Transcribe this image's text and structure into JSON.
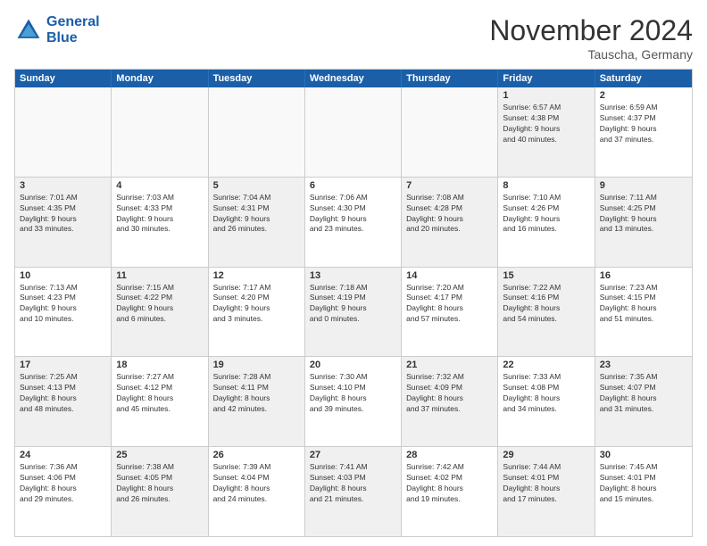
{
  "header": {
    "logo_line1": "General",
    "logo_line2": "Blue",
    "month": "November 2024",
    "location": "Tauscha, Germany"
  },
  "weekdays": [
    "Sunday",
    "Monday",
    "Tuesday",
    "Wednesday",
    "Thursday",
    "Friday",
    "Saturday"
  ],
  "rows": [
    [
      {
        "day": "",
        "info": "",
        "empty": true
      },
      {
        "day": "",
        "info": "",
        "empty": true
      },
      {
        "day": "",
        "info": "",
        "empty": true
      },
      {
        "day": "",
        "info": "",
        "empty": true
      },
      {
        "day": "",
        "info": "",
        "empty": true
      },
      {
        "day": "1",
        "info": "Sunrise: 6:57 AM\nSunset: 4:38 PM\nDaylight: 9 hours\nand 40 minutes.",
        "shaded": true
      },
      {
        "day": "2",
        "info": "Sunrise: 6:59 AM\nSunset: 4:37 PM\nDaylight: 9 hours\nand 37 minutes.",
        "shaded": false
      }
    ],
    [
      {
        "day": "3",
        "info": "Sunrise: 7:01 AM\nSunset: 4:35 PM\nDaylight: 9 hours\nand 33 minutes.",
        "shaded": true
      },
      {
        "day": "4",
        "info": "Sunrise: 7:03 AM\nSunset: 4:33 PM\nDaylight: 9 hours\nand 30 minutes.",
        "shaded": false
      },
      {
        "day": "5",
        "info": "Sunrise: 7:04 AM\nSunset: 4:31 PM\nDaylight: 9 hours\nand 26 minutes.",
        "shaded": true
      },
      {
        "day": "6",
        "info": "Sunrise: 7:06 AM\nSunset: 4:30 PM\nDaylight: 9 hours\nand 23 minutes.",
        "shaded": false
      },
      {
        "day": "7",
        "info": "Sunrise: 7:08 AM\nSunset: 4:28 PM\nDaylight: 9 hours\nand 20 minutes.",
        "shaded": true
      },
      {
        "day": "8",
        "info": "Sunrise: 7:10 AM\nSunset: 4:26 PM\nDaylight: 9 hours\nand 16 minutes.",
        "shaded": false
      },
      {
        "day": "9",
        "info": "Sunrise: 7:11 AM\nSunset: 4:25 PM\nDaylight: 9 hours\nand 13 minutes.",
        "shaded": true
      }
    ],
    [
      {
        "day": "10",
        "info": "Sunrise: 7:13 AM\nSunset: 4:23 PM\nDaylight: 9 hours\nand 10 minutes.",
        "shaded": false
      },
      {
        "day": "11",
        "info": "Sunrise: 7:15 AM\nSunset: 4:22 PM\nDaylight: 9 hours\nand 6 minutes.",
        "shaded": true
      },
      {
        "day": "12",
        "info": "Sunrise: 7:17 AM\nSunset: 4:20 PM\nDaylight: 9 hours\nand 3 minutes.",
        "shaded": false
      },
      {
        "day": "13",
        "info": "Sunrise: 7:18 AM\nSunset: 4:19 PM\nDaylight: 9 hours\nand 0 minutes.",
        "shaded": true
      },
      {
        "day": "14",
        "info": "Sunrise: 7:20 AM\nSunset: 4:17 PM\nDaylight: 8 hours\nand 57 minutes.",
        "shaded": false
      },
      {
        "day": "15",
        "info": "Sunrise: 7:22 AM\nSunset: 4:16 PM\nDaylight: 8 hours\nand 54 minutes.",
        "shaded": true
      },
      {
        "day": "16",
        "info": "Sunrise: 7:23 AM\nSunset: 4:15 PM\nDaylight: 8 hours\nand 51 minutes.",
        "shaded": false
      }
    ],
    [
      {
        "day": "17",
        "info": "Sunrise: 7:25 AM\nSunset: 4:13 PM\nDaylight: 8 hours\nand 48 minutes.",
        "shaded": true
      },
      {
        "day": "18",
        "info": "Sunrise: 7:27 AM\nSunset: 4:12 PM\nDaylight: 8 hours\nand 45 minutes.",
        "shaded": false
      },
      {
        "day": "19",
        "info": "Sunrise: 7:28 AM\nSunset: 4:11 PM\nDaylight: 8 hours\nand 42 minutes.",
        "shaded": true
      },
      {
        "day": "20",
        "info": "Sunrise: 7:30 AM\nSunset: 4:10 PM\nDaylight: 8 hours\nand 39 minutes.",
        "shaded": false
      },
      {
        "day": "21",
        "info": "Sunrise: 7:32 AM\nSunset: 4:09 PM\nDaylight: 8 hours\nand 37 minutes.",
        "shaded": true
      },
      {
        "day": "22",
        "info": "Sunrise: 7:33 AM\nSunset: 4:08 PM\nDaylight: 8 hours\nand 34 minutes.",
        "shaded": false
      },
      {
        "day": "23",
        "info": "Sunrise: 7:35 AM\nSunset: 4:07 PM\nDaylight: 8 hours\nand 31 minutes.",
        "shaded": true
      }
    ],
    [
      {
        "day": "24",
        "info": "Sunrise: 7:36 AM\nSunset: 4:06 PM\nDaylight: 8 hours\nand 29 minutes.",
        "shaded": false
      },
      {
        "day": "25",
        "info": "Sunrise: 7:38 AM\nSunset: 4:05 PM\nDaylight: 8 hours\nand 26 minutes.",
        "shaded": true
      },
      {
        "day": "26",
        "info": "Sunrise: 7:39 AM\nSunset: 4:04 PM\nDaylight: 8 hours\nand 24 minutes.",
        "shaded": false
      },
      {
        "day": "27",
        "info": "Sunrise: 7:41 AM\nSunset: 4:03 PM\nDaylight: 8 hours\nand 21 minutes.",
        "shaded": true
      },
      {
        "day": "28",
        "info": "Sunrise: 7:42 AM\nSunset: 4:02 PM\nDaylight: 8 hours\nand 19 minutes.",
        "shaded": false
      },
      {
        "day": "29",
        "info": "Sunrise: 7:44 AM\nSunset: 4:01 PM\nDaylight: 8 hours\nand 17 minutes.",
        "shaded": true
      },
      {
        "day": "30",
        "info": "Sunrise: 7:45 AM\nSunset: 4:01 PM\nDaylight: 8 hours\nand 15 minutes.",
        "shaded": false
      }
    ]
  ]
}
